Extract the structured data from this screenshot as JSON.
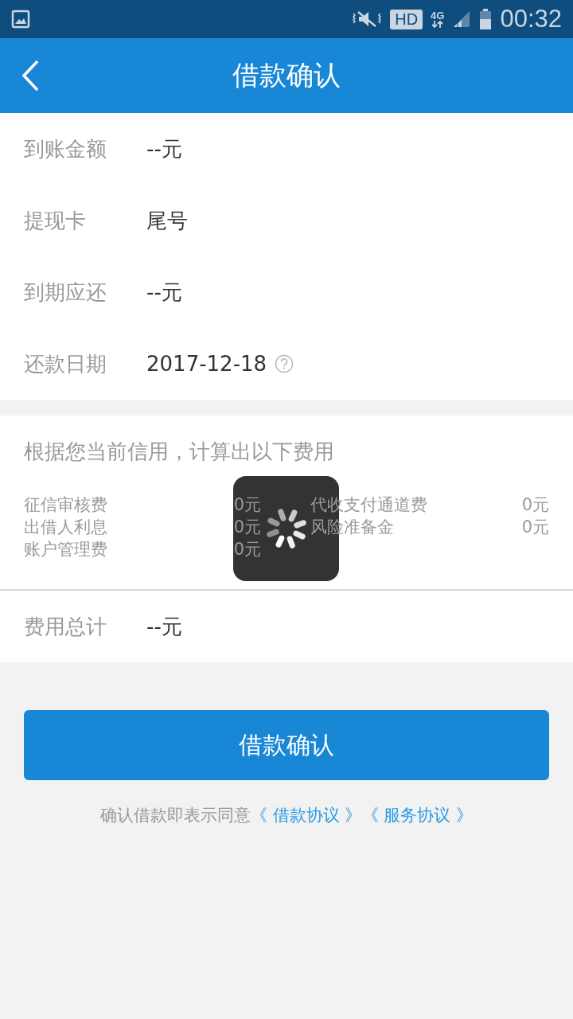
{
  "status_bar": {
    "network_badge": "HD",
    "network_type": "4G",
    "time": "00:32"
  },
  "header": {
    "title": "借款确认"
  },
  "details": [
    {
      "label": "到账金额",
      "value": "--元",
      "help": false
    },
    {
      "label": "提现卡",
      "value": "尾号",
      "help": false
    },
    {
      "label": "到期应还",
      "value": "--元",
      "help": false
    },
    {
      "label": "还款日期",
      "value": "2017-12-18",
      "help": true
    }
  ],
  "fees": {
    "heading": "根据您当前信用，计算出以下费用",
    "left": [
      {
        "label": "征信审核费",
        "value": "0元"
      },
      {
        "label": "出借人利息",
        "value": "0元"
      },
      {
        "label": "账户管理费",
        "value": "0元"
      }
    ],
    "right": [
      {
        "label": "代收支付通道费",
        "value": "0元"
      },
      {
        "label": "风险准备金",
        "value": "0元"
      }
    ]
  },
  "total": {
    "label": "费用总计",
    "value": "--元"
  },
  "confirm_button": "借款确认",
  "agreement": {
    "text": "确认借款即表示同意",
    "links": [
      "《 借款协议 》",
      "《 服务协议 》"
    ]
  },
  "loading": true
}
